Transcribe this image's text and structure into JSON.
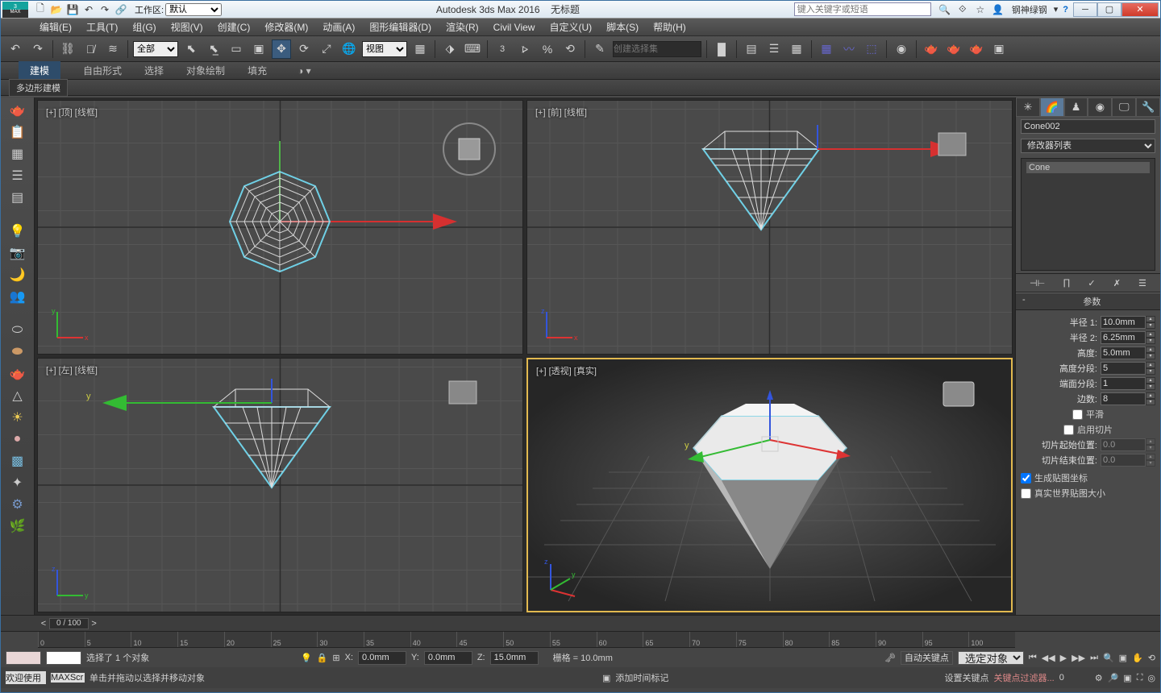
{
  "window": {
    "app_title": "Autodesk 3ds Max 2016",
    "doc_title": "无标题",
    "workspace_label": "工作区:",
    "workspace_value": "默认",
    "search_placeholder": "键入关键字或短语",
    "user": "钢神绿钢"
  },
  "menubar": [
    "编辑(E)",
    "工具(T)",
    "组(G)",
    "视图(V)",
    "创建(C)",
    "修改器(M)",
    "动画(A)",
    "图形编辑器(D)",
    "渲染(R)",
    "Civil View",
    "自定义(U)",
    "脚本(S)",
    "帮助(H)"
  ],
  "toolbar": {
    "sel_all": "全部",
    "view_dd": "视图",
    "selset_placeholder": "创建选择集"
  },
  "ribbon": {
    "tabs": [
      "建模",
      "自由形式",
      "选择",
      "对象绘制",
      "填充"
    ],
    "sub": "多边形建模"
  },
  "viewports": {
    "top": "[+] [顶] [线框]",
    "front": "[+] [前] [线框]",
    "left": "[+] [左] [线框]",
    "persp": "[+] [透视] [真实]"
  },
  "cmdpanel": {
    "object_name": "Cone002",
    "modlist_label": "修改器列表",
    "stack_item": "Cone",
    "rollout": "参数",
    "radius1_l": "半径 1:",
    "radius1_v": "10.0mm",
    "radius2_l": "半径 2:",
    "radius2_v": "6.25mm",
    "height_l": "高度:",
    "height_v": "5.0mm",
    "hseg_l": "高度分段:",
    "hseg_v": "5",
    "cseg_l": "端面分段:",
    "cseg_v": "1",
    "sides_l": "边数:",
    "sides_v": "8",
    "smooth": "平滑",
    "slice_on": "启用切片",
    "slice_from_l": "切片起始位置:",
    "slice_from_v": "0.0",
    "slice_to_l": "切片结束位置:",
    "slice_to_v": "0.0",
    "gen_map": "生成贴图坐标",
    "real_world": "真实世界贴图大小"
  },
  "timeline": {
    "slot": "0 / 100",
    "ticks": [
      "0",
      "5",
      "10",
      "15",
      "20",
      "25",
      "30",
      "35",
      "40",
      "45",
      "50",
      "55",
      "60",
      "65",
      "70",
      "75",
      "80",
      "85",
      "90",
      "95",
      "100"
    ]
  },
  "status": {
    "sel": "选择了 1 个对象",
    "x_l": "X:",
    "x_v": "0.0mm",
    "y_l": "Y:",
    "y_v": "0.0mm",
    "z_l": "Z:",
    "z_v": "15.0mm",
    "grid": "栅格 = 10.0mm",
    "autokey": "自动关键点",
    "selkey": "选定对象",
    "setkey": "设置关键点",
    "keyfilter": "关键点过滤器...",
    "welcome": "欢迎使用",
    "maxscr": "MAXScr",
    "hint": "单击并拖动以选择并移动对象",
    "addtimetag": "添加时间标记"
  }
}
